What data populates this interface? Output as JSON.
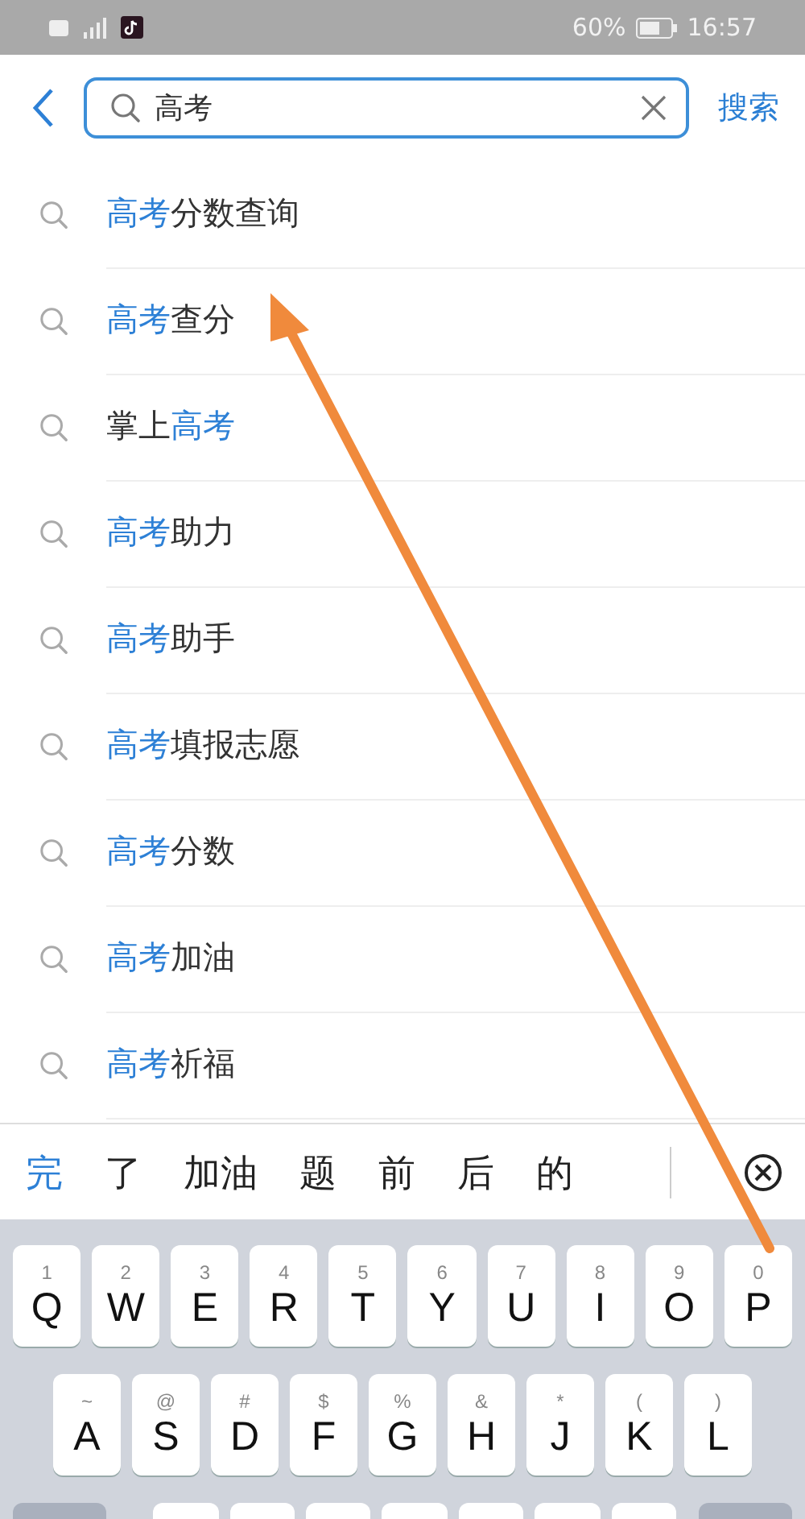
{
  "status_bar": {
    "battery": "60%",
    "time": "16:57"
  },
  "search": {
    "value": "高考",
    "action": "搜索"
  },
  "suggestions": [
    {
      "parts": [
        {
          "text": "高考",
          "highlight": true
        },
        {
          "text": "分数查询",
          "highlight": false
        }
      ]
    },
    {
      "parts": [
        {
          "text": "高考",
          "highlight": true
        },
        {
          "text": "查分",
          "highlight": false
        }
      ]
    },
    {
      "parts": [
        {
          "text": "掌上",
          "highlight": false
        },
        {
          "text": "高考",
          "highlight": true
        }
      ]
    },
    {
      "parts": [
        {
          "text": "高考",
          "highlight": true
        },
        {
          "text": "助力",
          "highlight": false
        }
      ]
    },
    {
      "parts": [
        {
          "text": "高考",
          "highlight": true
        },
        {
          "text": "助手",
          "highlight": false
        }
      ]
    },
    {
      "parts": [
        {
          "text": "高考",
          "highlight": true
        },
        {
          "text": "填报志愿",
          "highlight": false
        }
      ]
    },
    {
      "parts": [
        {
          "text": "高考",
          "highlight": true
        },
        {
          "text": "分数",
          "highlight": false
        }
      ]
    },
    {
      "parts": [
        {
          "text": "高考",
          "highlight": true
        },
        {
          "text": "加油",
          "highlight": false
        }
      ]
    },
    {
      "parts": [
        {
          "text": "高考",
          "highlight": true
        },
        {
          "text": "祈福",
          "highlight": false
        }
      ]
    }
  ],
  "candidates": [
    {
      "text": "完",
      "selected": true
    },
    {
      "text": "了",
      "selected": false
    },
    {
      "text": "加油",
      "selected": false
    },
    {
      "text": "题",
      "selected": false
    },
    {
      "text": "前",
      "selected": false
    },
    {
      "text": "后",
      "selected": false
    },
    {
      "text": "的",
      "selected": false
    }
  ],
  "keyboard": {
    "rows": [
      [
        {
          "sub": "1",
          "key": "Q"
        },
        {
          "sub": "2",
          "key": "W"
        },
        {
          "sub": "3",
          "key": "E"
        },
        {
          "sub": "4",
          "key": "R"
        },
        {
          "sub": "5",
          "key": "T"
        },
        {
          "sub": "6",
          "key": "Y"
        },
        {
          "sub": "7",
          "key": "U"
        },
        {
          "sub": "8",
          "key": "I"
        },
        {
          "sub": "9",
          "key": "O"
        },
        {
          "sub": "0",
          "key": "P"
        }
      ],
      [
        {
          "sub": "~",
          "key": "A"
        },
        {
          "sub": "@",
          "key": "S"
        },
        {
          "sub": "#",
          "key": "D"
        },
        {
          "sub": "$",
          "key": "F"
        },
        {
          "sub": "%",
          "key": "G"
        },
        {
          "sub": "&",
          "key": "H"
        },
        {
          "sub": "*",
          "key": "J"
        },
        {
          "sub": "(",
          "key": "K"
        },
        {
          "sub": ")",
          "key": "L"
        }
      ]
    ]
  }
}
